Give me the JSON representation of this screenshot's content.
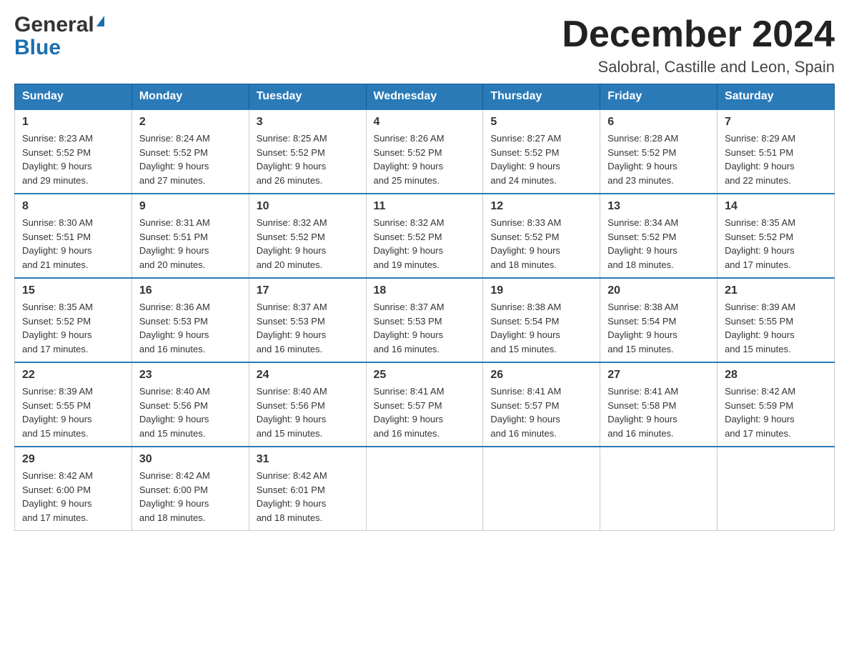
{
  "header": {
    "logo_general": "General",
    "logo_blue": "Blue",
    "month_title": "December 2024",
    "location": "Salobral, Castille and Leon, Spain"
  },
  "weekdays": [
    "Sunday",
    "Monday",
    "Tuesday",
    "Wednesday",
    "Thursday",
    "Friday",
    "Saturday"
  ],
  "weeks": [
    [
      {
        "day": "1",
        "sunrise": "8:23 AM",
        "sunset": "5:52 PM",
        "daylight": "9 hours and 29 minutes."
      },
      {
        "day": "2",
        "sunrise": "8:24 AM",
        "sunset": "5:52 PM",
        "daylight": "9 hours and 27 minutes."
      },
      {
        "day": "3",
        "sunrise": "8:25 AM",
        "sunset": "5:52 PM",
        "daylight": "9 hours and 26 minutes."
      },
      {
        "day": "4",
        "sunrise": "8:26 AM",
        "sunset": "5:52 PM",
        "daylight": "9 hours and 25 minutes."
      },
      {
        "day": "5",
        "sunrise": "8:27 AM",
        "sunset": "5:52 PM",
        "daylight": "9 hours and 24 minutes."
      },
      {
        "day": "6",
        "sunrise": "8:28 AM",
        "sunset": "5:52 PM",
        "daylight": "9 hours and 23 minutes."
      },
      {
        "day": "7",
        "sunrise": "8:29 AM",
        "sunset": "5:51 PM",
        "daylight": "9 hours and 22 minutes."
      }
    ],
    [
      {
        "day": "8",
        "sunrise": "8:30 AM",
        "sunset": "5:51 PM",
        "daylight": "9 hours and 21 minutes."
      },
      {
        "day": "9",
        "sunrise": "8:31 AM",
        "sunset": "5:51 PM",
        "daylight": "9 hours and 20 minutes."
      },
      {
        "day": "10",
        "sunrise": "8:32 AM",
        "sunset": "5:52 PM",
        "daylight": "9 hours and 20 minutes."
      },
      {
        "day": "11",
        "sunrise": "8:32 AM",
        "sunset": "5:52 PM",
        "daylight": "9 hours and 19 minutes."
      },
      {
        "day": "12",
        "sunrise": "8:33 AM",
        "sunset": "5:52 PM",
        "daylight": "9 hours and 18 minutes."
      },
      {
        "day": "13",
        "sunrise": "8:34 AM",
        "sunset": "5:52 PM",
        "daylight": "9 hours and 18 minutes."
      },
      {
        "day": "14",
        "sunrise": "8:35 AM",
        "sunset": "5:52 PM",
        "daylight": "9 hours and 17 minutes."
      }
    ],
    [
      {
        "day": "15",
        "sunrise": "8:35 AM",
        "sunset": "5:52 PM",
        "daylight": "9 hours and 17 minutes."
      },
      {
        "day": "16",
        "sunrise": "8:36 AM",
        "sunset": "5:53 PM",
        "daylight": "9 hours and 16 minutes."
      },
      {
        "day": "17",
        "sunrise": "8:37 AM",
        "sunset": "5:53 PM",
        "daylight": "9 hours and 16 minutes."
      },
      {
        "day": "18",
        "sunrise": "8:37 AM",
        "sunset": "5:53 PM",
        "daylight": "9 hours and 16 minutes."
      },
      {
        "day": "19",
        "sunrise": "8:38 AM",
        "sunset": "5:54 PM",
        "daylight": "9 hours and 15 minutes."
      },
      {
        "day": "20",
        "sunrise": "8:38 AM",
        "sunset": "5:54 PM",
        "daylight": "9 hours and 15 minutes."
      },
      {
        "day": "21",
        "sunrise": "8:39 AM",
        "sunset": "5:55 PM",
        "daylight": "9 hours and 15 minutes."
      }
    ],
    [
      {
        "day": "22",
        "sunrise": "8:39 AM",
        "sunset": "5:55 PM",
        "daylight": "9 hours and 15 minutes."
      },
      {
        "day": "23",
        "sunrise": "8:40 AM",
        "sunset": "5:56 PM",
        "daylight": "9 hours and 15 minutes."
      },
      {
        "day": "24",
        "sunrise": "8:40 AM",
        "sunset": "5:56 PM",
        "daylight": "9 hours and 15 minutes."
      },
      {
        "day": "25",
        "sunrise": "8:41 AM",
        "sunset": "5:57 PM",
        "daylight": "9 hours and 16 minutes."
      },
      {
        "day": "26",
        "sunrise": "8:41 AM",
        "sunset": "5:57 PM",
        "daylight": "9 hours and 16 minutes."
      },
      {
        "day": "27",
        "sunrise": "8:41 AM",
        "sunset": "5:58 PM",
        "daylight": "9 hours and 16 minutes."
      },
      {
        "day": "28",
        "sunrise": "8:42 AM",
        "sunset": "5:59 PM",
        "daylight": "9 hours and 17 minutes."
      }
    ],
    [
      {
        "day": "29",
        "sunrise": "8:42 AM",
        "sunset": "6:00 PM",
        "daylight": "9 hours and 17 minutes."
      },
      {
        "day": "30",
        "sunrise": "8:42 AM",
        "sunset": "6:00 PM",
        "daylight": "9 hours and 18 minutes."
      },
      {
        "day": "31",
        "sunrise": "8:42 AM",
        "sunset": "6:01 PM",
        "daylight": "9 hours and 18 minutes."
      },
      null,
      null,
      null,
      null
    ]
  ],
  "labels": {
    "sunrise": "Sunrise:",
    "sunset": "Sunset:",
    "daylight": "Daylight:"
  }
}
